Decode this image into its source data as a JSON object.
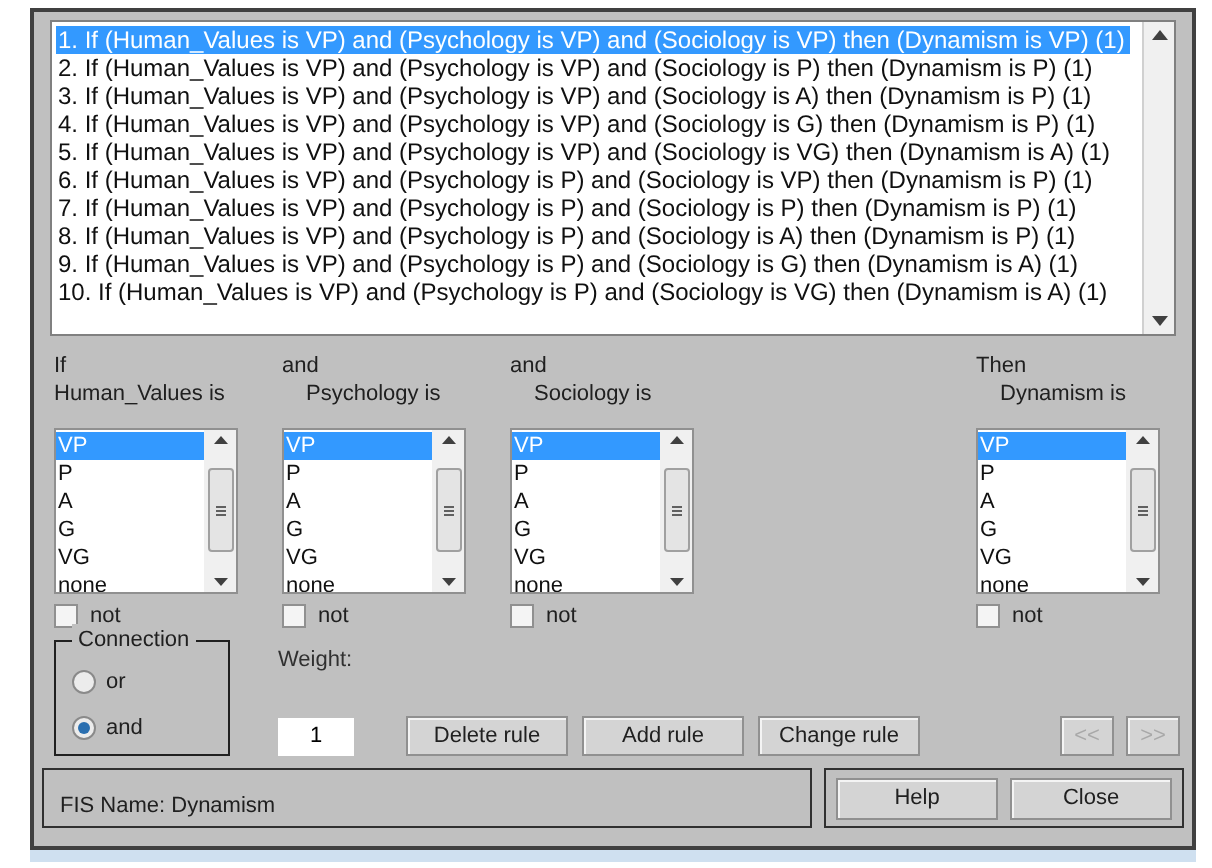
{
  "rules": [
    {
      "text": "1. If (Human_Values is VP) and (Psychology is VP) and (Sociology is VP) then (Dynamism is VP) (1)",
      "selected": true
    },
    {
      "text": "2. If (Human_Values is VP) and (Psychology is VP) and (Sociology is P) then (Dynamism is P) (1)",
      "selected": false
    },
    {
      "text": "3. If (Human_Values is VP) and (Psychology is VP) and (Sociology is A) then (Dynamism is P) (1)",
      "selected": false
    },
    {
      "text": "4. If (Human_Values is VP) and (Psychology is VP) and (Sociology is G) then (Dynamism is P) (1)",
      "selected": false
    },
    {
      "text": "5. If (Human_Values is VP) and (Psychology is VP) and (Sociology is VG) then (Dynamism is A) (1)",
      "selected": false
    },
    {
      "text": "6. If (Human_Values is VP) and (Psychology is P) and (Sociology is VP) then (Dynamism is P) (1)",
      "selected": false
    },
    {
      "text": "7. If (Human_Values is VP) and (Psychology is P) and (Sociology is P) then (Dynamism is P) (1)",
      "selected": false
    },
    {
      "text": "8. If (Human_Values is VP) and (Psychology is P) and (Sociology is A) then (Dynamism is P) (1)",
      "selected": false
    },
    {
      "text": "9. If (Human_Values is VP) and (Psychology is P) and (Sociology is G) then (Dynamism is A) (1)",
      "selected": false
    },
    {
      "text": "10. If (Human_Values is VP) and (Psychology is P) and (Sociology is VG) then (Dynamism is A) (1)",
      "selected": false
    }
  ],
  "variables": [
    {
      "kind": "input",
      "connector": "If",
      "label": "Human_Values is",
      "options": [
        {
          "label": "VP",
          "selected": true
        },
        {
          "label": "P",
          "selected": false
        },
        {
          "label": "A",
          "selected": false
        },
        {
          "label": "G",
          "selected": false
        },
        {
          "label": "VG",
          "selected": false
        },
        {
          "label": "none",
          "selected": false
        }
      ],
      "not": {
        "label": "not",
        "checked": false
      }
    },
    {
      "kind": "input",
      "connector": "and",
      "label": "Psychology is",
      "options": [
        {
          "label": "VP",
          "selected": true
        },
        {
          "label": "P",
          "selected": false
        },
        {
          "label": "A",
          "selected": false
        },
        {
          "label": "G",
          "selected": false
        },
        {
          "label": "VG",
          "selected": false
        },
        {
          "label": "none",
          "selected": false
        }
      ],
      "not": {
        "label": "not",
        "checked": false
      }
    },
    {
      "kind": "input",
      "connector": "and",
      "label": "Sociology is",
      "options": [
        {
          "label": "VP",
          "selected": true
        },
        {
          "label": "P",
          "selected": false
        },
        {
          "label": "A",
          "selected": false
        },
        {
          "label": "G",
          "selected": false
        },
        {
          "label": "VG",
          "selected": false
        },
        {
          "label": "none",
          "selected": false
        }
      ],
      "not": {
        "label": "not",
        "checked": false
      }
    },
    {
      "kind": "output",
      "connector": "Then",
      "label": "Dynamism is",
      "options": [
        {
          "label": "VP",
          "selected": true
        },
        {
          "label": "P",
          "selected": false
        },
        {
          "label": "A",
          "selected": false
        },
        {
          "label": "G",
          "selected": false
        },
        {
          "label": "VG",
          "selected": false
        },
        {
          "label": "none",
          "selected": false
        }
      ],
      "not": {
        "label": "not",
        "checked": false
      }
    }
  ],
  "connection": {
    "title": "Connection",
    "options": [
      {
        "label": "or",
        "selected": false
      },
      {
        "label": "and",
        "selected": true
      }
    ]
  },
  "weight": {
    "label": "Weight:",
    "value": "1"
  },
  "rule_buttons": [
    {
      "label": "Delete rule",
      "disabled": false
    },
    {
      "label": "Add rule",
      "disabled": false
    },
    {
      "label": "Change rule",
      "disabled": false
    }
  ],
  "nav_buttons": [
    {
      "label": "<<",
      "disabled": true
    },
    {
      "label": ">>",
      "disabled": true
    }
  ],
  "status": "FIS Name: Dynamism",
  "dialog_buttons": [
    {
      "label": "Help",
      "disabled": false
    },
    {
      "label": "Close",
      "disabled": false
    }
  ]
}
